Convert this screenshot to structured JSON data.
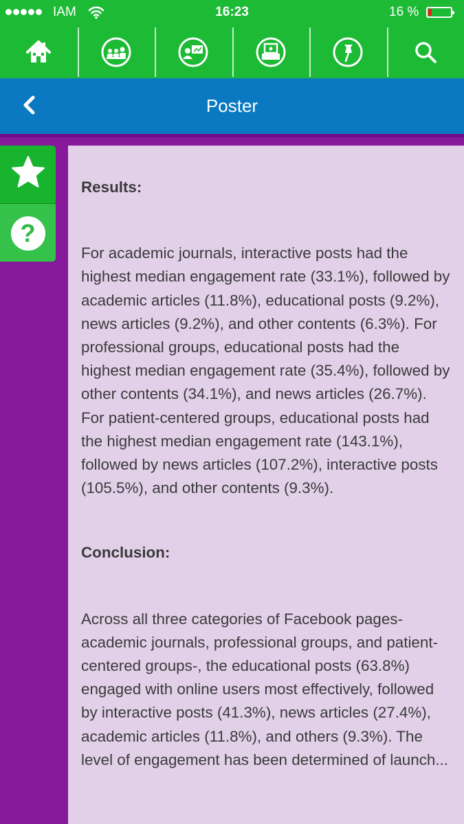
{
  "status_bar": {
    "carrier": "IAM",
    "time": "16:23",
    "battery_percent": "16 %",
    "battery_level": 0.16,
    "battery_color": "#e8201a"
  },
  "nav": {
    "items": [
      {
        "name": "home",
        "icon": "home-icon"
      },
      {
        "name": "attendees",
        "icon": "audience-icon"
      },
      {
        "name": "presenter",
        "icon": "presentation-icon"
      },
      {
        "name": "booth",
        "icon": "booth-icon"
      },
      {
        "name": "pin",
        "icon": "pushpin-icon"
      },
      {
        "name": "search",
        "icon": "search-icon"
      }
    ]
  },
  "header": {
    "back_icon": "chevron-left-icon",
    "title": "Poster"
  },
  "side_actions": {
    "favorite_icon": "star-icon",
    "help_label": "?"
  },
  "content": {
    "results_heading": "Results:",
    "results_text": "For academic journals, interactive posts had the highest median engagement rate (33.1%), followed by academic articles (11.8%), educational posts (9.2%), news articles (9.2%), and other contents (6.3%). For professional groups, educational posts had the highest median engagement rate (35.4%), followed by other contents (34.1%), and news articles (26.7%). For patient-centered groups, educational posts had the highest median engagement rate (143.1%), followed by news articles (107.2%), interactive posts (105.5%), and other contents (9.3%).",
    "conclusion_heading": "Conclusion:",
    "conclusion_text": "Across all three categories of Facebook pages- academic journals, professional groups, and patient-centered groups-, the educational posts (63.8%) engaged with online users most effectively, followed by interactive posts (41.3%), news articles (27.4%), academic articles (11.8%), and others (9.3%). The level of engagement has been determined of launch..."
  },
  "colors": {
    "toolbar_green": "#1dba35",
    "header_blue": "#0a79c2",
    "page_purple": "#86189a",
    "panel_lilac": "#e2d0e9"
  }
}
